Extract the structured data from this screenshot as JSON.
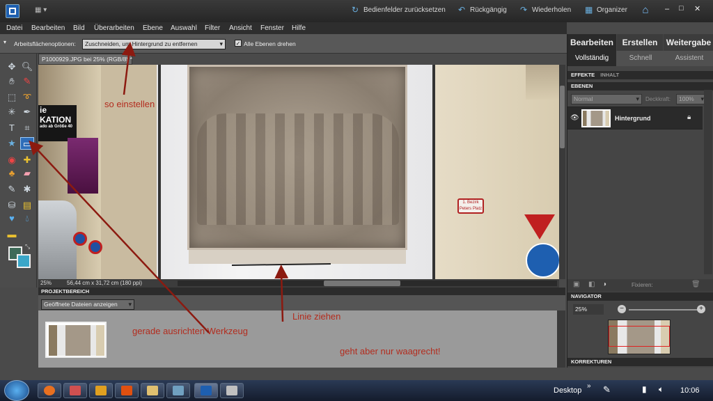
{
  "titlebar": {
    "reset_panels": "Bedienfelder zurücksetzen",
    "undo": "Rückgängig",
    "redo": "Wiederholen",
    "organizer": "Organizer",
    "win_min": "–",
    "win_max": "□",
    "win_close": "✕"
  },
  "menu": [
    "Datei",
    "Bearbeiten",
    "Bild",
    "Überarbeiten",
    "Ebene",
    "Auswahl",
    "Filter",
    "Ansicht",
    "Fenster",
    "Hilfe"
  ],
  "options": {
    "label": "Arbeitsflächenoptionen:",
    "select_value": "Zuschneiden, um Hintergrund zu entfernen",
    "checkbox_label": "Alle Ebenen drehen",
    "checkbox_checked": true
  },
  "document": {
    "tab_title": "P1000929.JPG bei 25% (RGB/8) *",
    "tab_close": "×",
    "zoom": "25%",
    "dimensions": "56,44 cm x 31,72 cm (180 ppi)",
    "sign_text_1": "1. Bezirk",
    "sign_text_2": "Peters Platz",
    "banner_line1": "ie",
    "banner_line2": "KATION",
    "banner_line3": "ado ab Größe 40"
  },
  "project": {
    "header": "PROJEKTBEREICH",
    "select_value": "Geöffnete Dateien anzeigen"
  },
  "annotations": {
    "so_einstellen": "so einstellen",
    "linie_ziehen": "Linie ziehen",
    "gerade_ausrichten": "gerade ausrichten Werkzeug",
    "nur_waagrecht": "geht aber nur waagrecht!"
  },
  "right_panel": {
    "tabs": [
      "Bearbeiten",
      "Erstellen",
      "Weitergabe"
    ],
    "subtabs": [
      "Vollständig",
      "Schnell",
      "Assistent"
    ],
    "effects_tab": "EFFEKTE",
    "content_tab": "INHALT",
    "layers_header": "EBENEN",
    "blend_mode": "Normal",
    "opacity_label": "Deckkraft:",
    "opacity_value": "100%",
    "layer_name": "Hintergrund",
    "lock_label": "Fixieren:",
    "navigator_header": "NAVIGATOR",
    "nav_zoom": "25%",
    "corrections_header": "KORREKTUREN"
  },
  "taskbar": {
    "desktop_label": "Desktop",
    "clock": "10:06"
  },
  "colors": {
    "accent_red": "#b32c1e",
    "panel_dark": "#2a2a2a"
  }
}
